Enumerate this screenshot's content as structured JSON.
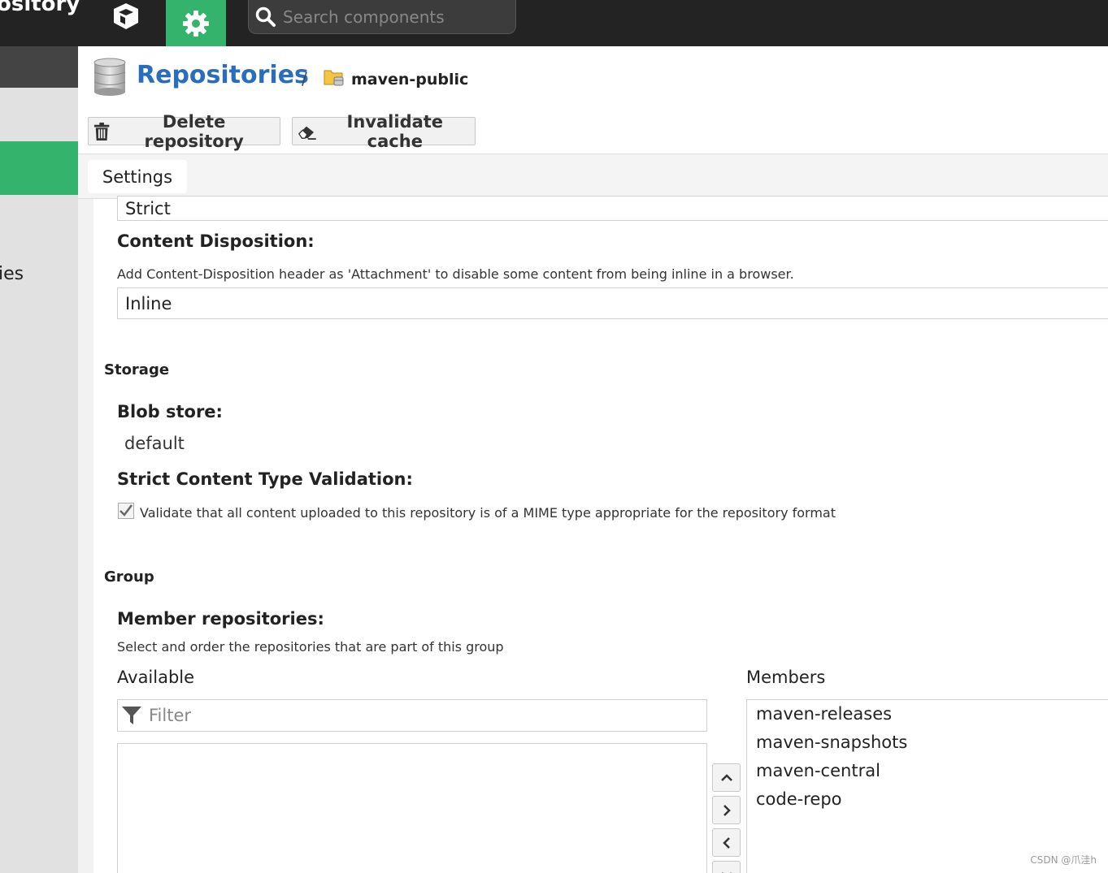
{
  "topbar": {
    "brand": "ository",
    "search_placeholder": "Search components"
  },
  "sidebar": {
    "partial_label": "ies"
  },
  "header": {
    "breadcrumb_main": "Repositories",
    "breadcrumb_sep": "/",
    "breadcrumb_sub": "maven-public",
    "delete_label": "Delete repository",
    "invalidate_label": "Invalidate cache"
  },
  "tabs": [
    {
      "label": "Settings"
    }
  ],
  "form": {
    "routing_value": "Strict",
    "content_disposition": {
      "label": "Content Disposition:",
      "help": "Add Content-Disposition header as 'Attachment' to disable some content from being inline in a browser.",
      "value": "Inline"
    },
    "storage": {
      "title": "Storage",
      "blob_label": "Blob store:",
      "blob_value": "default",
      "strict_label": "Strict Content Type Validation:",
      "strict_help": "Validate that all content uploaded to this repository is of a MIME type appropriate for the repository format",
      "strict_checked": true
    },
    "group": {
      "title": "Group",
      "members_label": "Member repositories:",
      "members_help": "Select and order the repositories that are part of this group",
      "available_label": "Available",
      "members_col_label": "Members",
      "filter_placeholder": "Filter",
      "available_items": [],
      "members": [
        "maven-releases",
        "maven-snapshots",
        "maven-central",
        "code-repo"
      ]
    }
  },
  "watermark": "CSDN @爪洼h",
  "colors": {
    "topbar": "#232323",
    "accent_green": "#33b36b",
    "link_blue": "#2a6ebb"
  }
}
